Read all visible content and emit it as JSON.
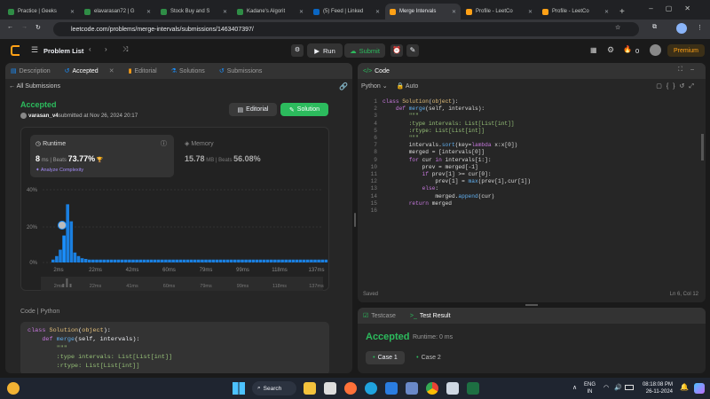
{
  "browser": {
    "tabs": [
      {
        "title": "Practice | Geeks",
        "color": "#2f8d46",
        "active": false
      },
      {
        "title": "elavarasan72 | G",
        "color": "#2f8d46",
        "active": false
      },
      {
        "title": "Stock Buy and S",
        "color": "#2f8d46",
        "active": false
      },
      {
        "title": "Kadane's Algorit",
        "color": "#2f8d46",
        "active": false
      },
      {
        "title": "(5) Feed | Linked",
        "color": "#0a66c2",
        "active": false
      },
      {
        "title": "Merge Intervals",
        "color": "#ffa116",
        "active": true
      },
      {
        "title": "Profile - LeetCo",
        "color": "#ffa116",
        "active": false
      },
      {
        "title": "Profile - LeetCo",
        "color": "#ffa116",
        "active": false
      }
    ],
    "url": "leetcode.com/problems/merge-intervals/submissions/1463407397/",
    "new_tab": "+"
  },
  "header": {
    "problem_list": "Problem List",
    "run": "Run",
    "submit": "Submit",
    "coins": "0",
    "premium": "Premium"
  },
  "left": {
    "tabs": {
      "description": "Description",
      "accepted": "Accepted",
      "editorial": "Editorial",
      "solutions": "Solutions",
      "submissions": "Submissions"
    },
    "back": "All Submissions",
    "status": "Accepted",
    "user": "varasan_v4",
    "submitted": " submitted at Nov 26, 2024 20:17",
    "editorial_btn": "Editorial",
    "solution_btn": "Solution",
    "runtime": {
      "label": "Runtime",
      "value": "8",
      "unit": "ms",
      "beats": "Beats",
      "pct": "73.77%",
      "analyze": "Analyze Complexity"
    },
    "memory": {
      "label": "Memory",
      "value": "15.78",
      "unit": "MB",
      "beats": "Beats",
      "pct": "56.08%"
    },
    "chart": {
      "ylabels": [
        "40%",
        "20%",
        "0%"
      ],
      "xlabels": [
        "2ms",
        "22ms",
        "42ms",
        "60ms",
        "79ms",
        "99ms",
        "118ms",
        "137ms"
      ],
      "mini_labels": [
        "2ms",
        "22ms",
        "41ms",
        "60ms",
        "79ms",
        "99ms",
        "118ms",
        "137ms"
      ]
    },
    "code_lang": {
      "code": "Code",
      "lang": "Python"
    },
    "code_lines": [
      "class Solution(object):",
      "    def merge(self, intervals):",
      "        \"\"\"",
      "        :type intervals: List[List[int]]",
      "        :rtype: List[List[int]]"
    ]
  },
  "right": {
    "code_tab": "Code",
    "lang": "Python",
    "auto": "Auto",
    "lines": [
      "class Solution(object):",
      "    def merge(self, intervals):",
      "        \"\"\"",
      "        :type intervals: List[List[int]]",
      "        :rtype: List[List[int]]",
      "        \"\"\"",
      "        intervals.sort(key=lambda x:x[0])",
      "        merged = [intervals[0]]",
      "        for cur in intervals[1:]:",
      "            prev = merged[-1]",
      "            if prev[1] >= cur[0]:",
      "                prev[1] = max(prev[1],cur[1])",
      "            else:",
      "                merged.append(cur)",
      "        return merged",
      ""
    ],
    "saved": "Saved",
    "cursor": "Ln 6, Col 12",
    "testcase": "Testcase",
    "testresult": "Test Result",
    "accepted": "Accepted",
    "runtime": "Runtime: 0 ms",
    "case1": "Case 1",
    "case2": "Case 2"
  },
  "taskbar": {
    "search": "Search",
    "lang1": "ENG",
    "lang2": "IN",
    "time": "08:18:08 PM",
    "date": "26-11-2024"
  },
  "colors": {
    "green": "#2cbb5d",
    "orange": "#ffa116",
    "blue": "#1a90ff"
  }
}
